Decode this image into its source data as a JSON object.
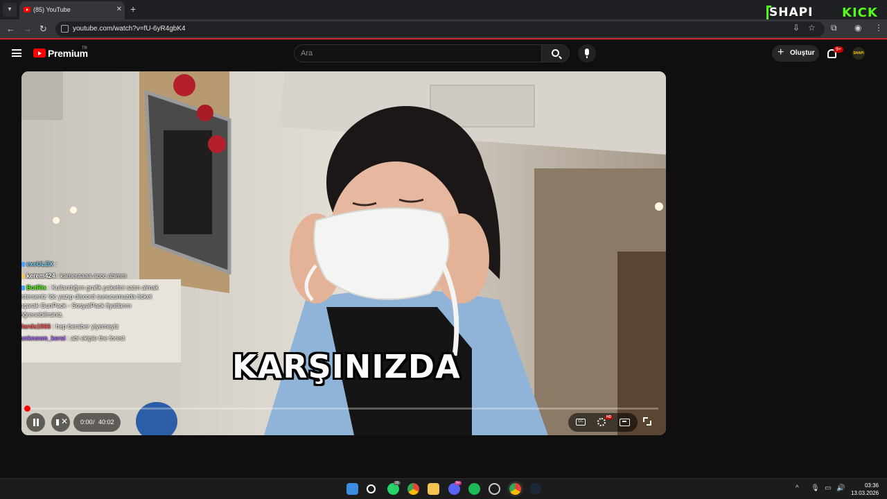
{
  "browser": {
    "tab_title": "(85) YouTube",
    "new_tab_symbol": "+",
    "url": "youtube.com/watch?v=fU-6yR4gbK4",
    "overlay_brand_left": "SHAPI",
    "overlay_brand_right": "KICK"
  },
  "youtube": {
    "logo_text": "Premium",
    "region": "TR",
    "search_placeholder": "Ara",
    "create_label": "Oluştur",
    "notification_count": "9+",
    "avatar_text": "SHAPI"
  },
  "player": {
    "caption": "KARŞINIZDA",
    "current_time": "0:00",
    "duration": "40:02",
    "progress_fraction": 0.0,
    "quality_badge": "HD",
    "chat": [
      {
        "user": "exeULEX",
        "text": " : ",
        "user_color": "#7fd3ff",
        "icon_color": "#4aa3ff"
      },
      {
        "user": "kerem424",
        "text": " : kameraaaa accc abimm",
        "user_color": "#ffffff",
        "icon_color": "#f2c94c"
      },
      {
        "user": "BotRix",
        "text": " : Kullandığım grafik paketini satın almak isterseniz !dc yazıp discord sunucumuzda ticket açarak GunPack - SosyalPack fiyatlarını öğrenebilirsiniz.",
        "user_color": "#53fc18",
        "icon_color": "#4aa3ff"
      },
      {
        "user": "0ards1966",
        "text": " : hep beraber yiyemeyiz",
        "user_color": "#ff5c5c",
        "icon_color": ""
      },
      {
        "user": "unknown_kersi",
        "text": " : abi ekiple the forest",
        "user_color": "#b06cff",
        "icon_color": ""
      }
    ]
  },
  "taskbar": {
    "whatsapp_badge": "26",
    "discord_badge": "9+",
    "time": "03:36",
    "date": "13.03.2026"
  },
  "colors": {
    "accent": "#ff0000",
    "kick_green": "#53fc18",
    "page_bg": "#0f0f0f"
  }
}
